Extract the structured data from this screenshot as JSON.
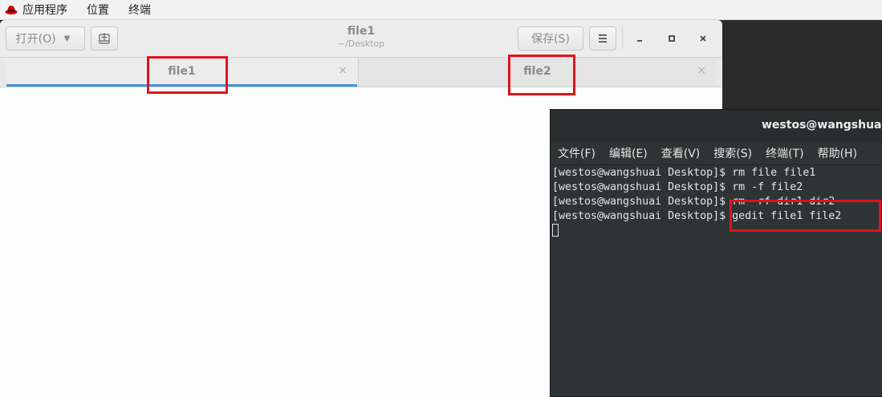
{
  "top_panel": {
    "applications": "应用程序",
    "places": "位置",
    "terminal": "终端"
  },
  "gedit": {
    "open_label": "打开(O)",
    "save_label": "保存(S)",
    "title": "file1",
    "subtitle": "~/Desktop",
    "tabs": [
      {
        "label": "file1",
        "close": "×"
      },
      {
        "label": "file2",
        "close": "×"
      }
    ]
  },
  "terminal": {
    "title": "westos@wangshuai:~/",
    "menu": [
      "文件(F)",
      "编辑(E)",
      "查看(V)",
      "搜索(S)",
      "终端(T)",
      "帮助(H)"
    ],
    "lines": [
      "[westos@wangshuai Desktop]$ rm file file1",
      "[westos@wangshuai Desktop]$ rm -f file2",
      "[westos@wangshuai Desktop]$ rm -rf dir1 dir2",
      "[westos@wangshuai Desktop]$ gedit file1 file2"
    ]
  },
  "colors": {
    "highlight": "#e0131c",
    "tab_active": "#4a90d9",
    "terminal_bg": "#2e3436"
  }
}
